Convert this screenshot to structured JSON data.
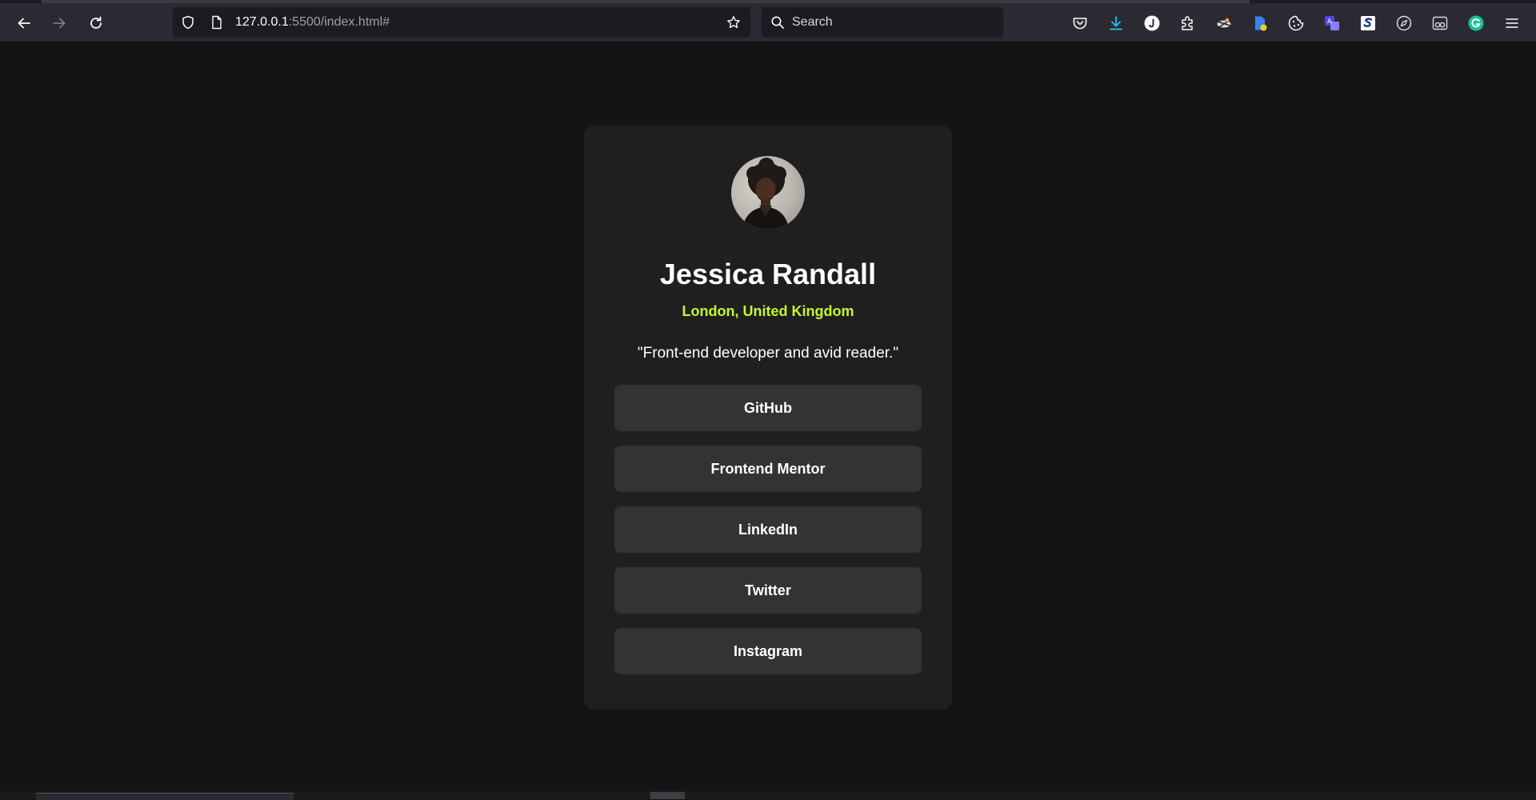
{
  "browser": {
    "url_host": "127.0.0.1",
    "url_rest": ":5500/index.html#",
    "search_placeholder": "Search",
    "toolbar_icons": [
      "back-icon",
      "forward-icon",
      "reload-icon",
      "shield-icon",
      "page-icon",
      "star-icon",
      "search-icon"
    ],
    "extension_icons": [
      "pocket-icon",
      "download-icon",
      "j-extension-icon",
      "puzzle-icon",
      "extension-icon",
      "file-extension-icon",
      "cookie-icon",
      "translate-icon",
      "s-extension-icon",
      "compass-icon",
      "glasses-icon",
      "grammarly-icon",
      "menu-icon"
    ],
    "colors": {
      "toolbar": "#2b2a33",
      "field": "#1c1b22",
      "download_accent": "#20c3f0",
      "grammarly": "#15c39a"
    }
  },
  "profile": {
    "name": "Jessica Randall",
    "location": "London, United Kingdom",
    "bio": "\"Front-end developer and avid reader.\"",
    "links": [
      {
        "label": "GitHub"
      },
      {
        "label": "Frontend Mentor"
      },
      {
        "label": "LinkedIn"
      },
      {
        "label": "Twitter"
      },
      {
        "label": "Instagram"
      }
    ],
    "colors": {
      "page_bg": "#141414",
      "card_bg": "#1f1f1f",
      "button_bg": "#333333",
      "accent_green": "#c4f82a",
      "text": "#ffffff"
    }
  }
}
